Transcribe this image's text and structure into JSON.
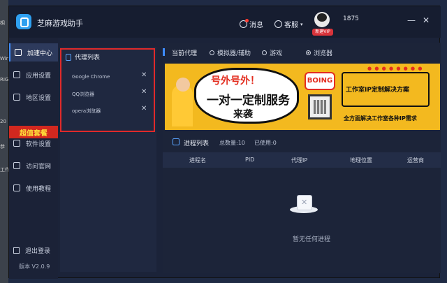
{
  "desktop": {
    "fragments": [
      "枂",
      "Windows",
      "RIGG",
      "20",
      "恭",
      "工作"
    ]
  },
  "window": {
    "title": "芝麻游戏助手",
    "messages_label": "消息",
    "service_label": "客服",
    "service_caret": "▾",
    "vip_badge": "新建VIP",
    "username": "1875",
    "minimize": "—",
    "close": "✕"
  },
  "sidebar": {
    "items": [
      {
        "label": "加速中心",
        "active": true
      },
      {
        "label": "应用设置"
      },
      {
        "label": "地区设置"
      },
      {
        "label": "软件设置"
      },
      {
        "label": "访问官网"
      },
      {
        "label": "使用教程"
      }
    ],
    "promo": "超值套餐",
    "logout": "退出登录",
    "version": "版本 V2.0.9"
  },
  "proxy_panel": {
    "title": "代理列表",
    "items": [
      "Google Chrome",
      "QQ浏览器",
      "opera浏览器"
    ]
  },
  "current_proxy": {
    "label": "当前代理",
    "options": [
      "模拟器/辅助",
      "游戏",
      "浏览器"
    ],
    "selected": "浏览器"
  },
  "banner": {
    "line1": "号外号外！",
    "line2": "一对一定制服务",
    "line3": "来袭",
    "boing": "BOING",
    "box_text": "工作室IP定制解决方案",
    "sub_text": "全方面解决工作室各种IP需求"
  },
  "process": {
    "title": "进程列表",
    "total": "总数量:10",
    "used": "已使用:0",
    "columns": [
      "进程名",
      "PID",
      "代理IP",
      "地理位置",
      "运营商"
    ],
    "empty": "暂无任何进程"
  },
  "colors": {
    "accent": "#3e8cff",
    "promo": "#d2281f",
    "outline": "#e02a2a",
    "banner": "#f3b91f"
  }
}
